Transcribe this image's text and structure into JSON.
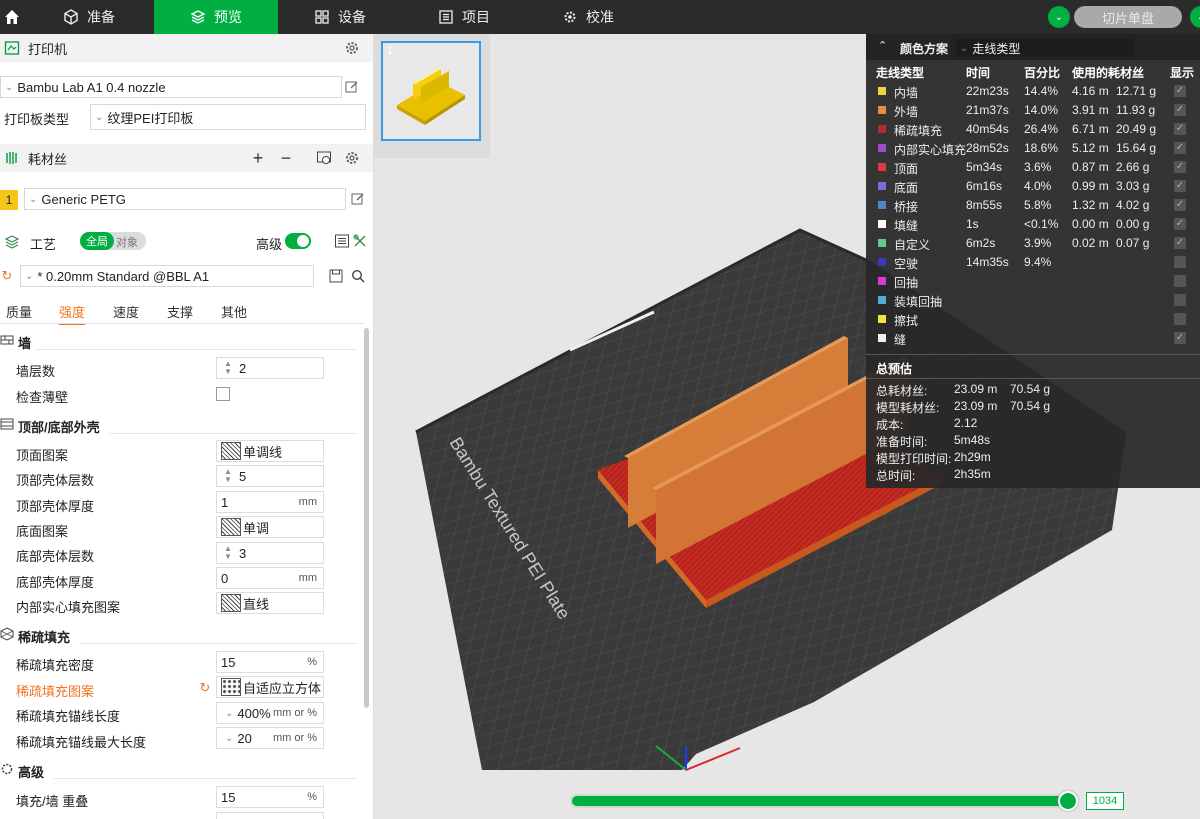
{
  "topbar": {
    "tabs": [
      {
        "label": "准备",
        "icon": "cube-icon"
      },
      {
        "label": "预览",
        "icon": "layers-icon",
        "active": true
      },
      {
        "label": "设备",
        "icon": "device-icon"
      },
      {
        "label": "项目",
        "icon": "list-icon"
      },
      {
        "label": "校准",
        "icon": "gear-icon"
      }
    ],
    "slice_button": "切片单盘",
    "accent": "#00ae42"
  },
  "printer": {
    "title": "打印机",
    "model": "Bambu Lab A1 0.4 nozzle",
    "plate_type_label": "打印板类型",
    "plate_type": "纹理PEI打印板"
  },
  "filament": {
    "title": "耗材丝",
    "slot": "1",
    "name": "Generic PETG",
    "slot_color": "#f5c518"
  },
  "process": {
    "title": "工艺",
    "toggle_global": "全局",
    "toggle_object": "对象",
    "advanced_label": "高级",
    "profile": "* 0.20mm Standard @BBL A1"
  },
  "subtabs": [
    "质量",
    "强度",
    "速度",
    "支撑",
    "其他"
  ],
  "settings": {
    "wall_group": "墙",
    "wall_loops_label": "墙层数",
    "wall_loops": "2",
    "detect_thin_label": "检查薄壁",
    "shell_group": "顶部/底部外壳",
    "top_pattern_label": "顶面图案",
    "top_pattern": "单调线",
    "top_layers_label": "顶部壳体层数",
    "top_layers": "5",
    "top_thickness_label": "顶部壳体厚度",
    "top_thickness": "1",
    "bottom_pattern_label": "底面图案",
    "bottom_pattern": "单调",
    "bottom_layers_label": "底部壳体层数",
    "bottom_layers": "3",
    "bottom_thickness_label": "底部壳体厚度",
    "bottom_thickness": "0",
    "internal_solid_label": "内部实心填充图案",
    "internal_solid": "直线",
    "infill_group": "稀疏填充",
    "density_label": "稀疏填充密度",
    "density": "15",
    "infill_pattern_label": "稀疏填充图案",
    "infill_pattern": "自适应立方体",
    "anchor_len_label": "稀疏填充锚线长度",
    "anchor_len": "400%",
    "anchor_max_label": "稀疏填充锚线最大长度",
    "anchor_max": "20",
    "advanced_group": "高级",
    "overlap_label": "填充/墙 重叠",
    "overlap": "15",
    "unit_mm": "mm",
    "unit_pct": "%",
    "unit_mm_or_pct": "mm or %"
  },
  "canvas": {
    "plate_number": "1",
    "plate_name": "Bambu Textured PEI Plate"
  },
  "legend": {
    "title": "颜色方案",
    "scheme": "走线类型",
    "columns": [
      "走线类型",
      "时间",
      "百分比",
      "使用的耗材丝",
      "显示"
    ],
    "rows": [
      {
        "name": "内墙",
        "color": "#f3d33c",
        "time": "22m23s",
        "pct": "14.4%",
        "len": "4.16 m",
        "weight": "12.71 g",
        "shown": true
      },
      {
        "name": "外墙",
        "color": "#f08a3c",
        "time": "21m37s",
        "pct": "14.0%",
        "len": "3.91 m",
        "weight": "11.93 g",
        "shown": true
      },
      {
        "name": "稀疏填充",
        "color": "#b52a2a",
        "time": "40m54s",
        "pct": "26.4%",
        "len": "6.71 m",
        "weight": "20.49 g",
        "shown": true
      },
      {
        "name": "内部实心填充",
        "color": "#9b4ad1",
        "time": "28m52s",
        "pct": "18.6%",
        "len": "5.12 m",
        "weight": "15.64 g",
        "shown": true
      },
      {
        "name": "顶面",
        "color": "#e0394a",
        "time": "5m34s",
        "pct": "3.6%",
        "len": "0.87 m",
        "weight": "2.66 g",
        "shown": true
      },
      {
        "name": "底面",
        "color": "#7d6bd6",
        "time": "6m16s",
        "pct": "4.0%",
        "len": "0.99 m",
        "weight": "3.03 g",
        "shown": true
      },
      {
        "name": "桥接",
        "color": "#4f86c6",
        "time": "8m55s",
        "pct": "5.8%",
        "len": "1.32 m",
        "weight": "4.02 g",
        "shown": true
      },
      {
        "name": "填缝",
        "color": "#ffffff",
        "time": "1s",
        "pct": "<0.1%",
        "len": "0.00 m",
        "weight": "0.00 g",
        "shown": true
      },
      {
        "name": "自定义",
        "color": "#5ecb8a",
        "time": "6m2s",
        "pct": "3.9%",
        "len": "0.02 m",
        "weight": "0.07 g",
        "shown": true
      },
      {
        "name": "空驶",
        "color": "#3a3ab8",
        "time": "14m35s",
        "pct": "9.4%",
        "len": "",
        "weight": "",
        "shown": false
      },
      {
        "name": "回抽",
        "color": "#d63ad6",
        "time": "",
        "pct": "",
        "len": "",
        "weight": "",
        "shown": false
      },
      {
        "name": "装填回抽",
        "color": "#4ab0d6",
        "time": "",
        "pct": "",
        "len": "",
        "weight": "",
        "shown": false
      },
      {
        "name": "擦拭",
        "color": "#f5e33c",
        "time": "",
        "pct": "",
        "len": "",
        "weight": "",
        "shown": false
      },
      {
        "name": "缝",
        "color": "#f0f0f0",
        "time": "",
        "pct": "",
        "len": "",
        "weight": "",
        "shown": true
      }
    ],
    "estimate_title": "总预估",
    "estimate": [
      {
        "label": "总耗材丝:",
        "v1": "23.09 m",
        "v2": "70.54 g"
      },
      {
        "label": "模型耗材丝:",
        "v1": "23.09 m",
        "v2": "70.54 g"
      },
      {
        "label": "成本:",
        "v1": "2.12",
        "v2": ""
      },
      {
        "label": "准备时间:",
        "v1": "5m48s",
        "v2": ""
      },
      {
        "label": "模型打印时间:",
        "v1": "2h29m",
        "v2": ""
      },
      {
        "label": "总时间:",
        "v1": "2h35m",
        "v2": ""
      }
    ]
  },
  "layer_slider": {
    "value": "1034"
  }
}
